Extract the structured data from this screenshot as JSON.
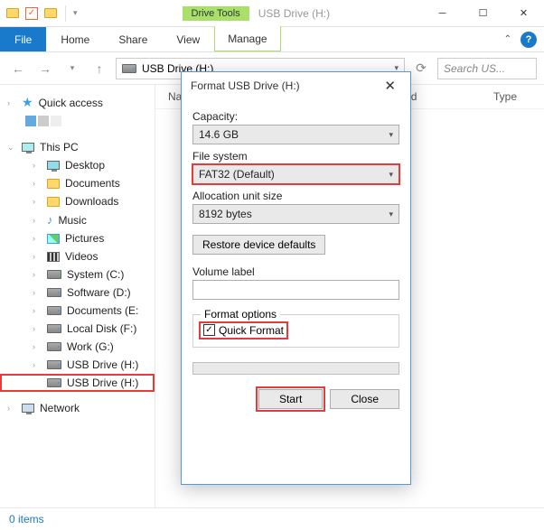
{
  "window": {
    "drive_tools_label": "Drive Tools",
    "title": "USB Drive (H:)"
  },
  "ribbon": {
    "file": "File",
    "home": "Home",
    "share": "Share",
    "view": "View",
    "manage": "Manage"
  },
  "address": {
    "location": "USB Drive (H:)",
    "search_placeholder": "Search US..."
  },
  "columns": {
    "name": "Name",
    "modified": "e modified",
    "type": "Type"
  },
  "sidebar": {
    "quick_access": "Quick access",
    "this_pc": "This PC",
    "items": [
      {
        "label": "Desktop"
      },
      {
        "label": "Documents"
      },
      {
        "label": "Downloads"
      },
      {
        "label": "Music"
      },
      {
        "label": "Pictures"
      },
      {
        "label": "Videos"
      },
      {
        "label": "System (C:)"
      },
      {
        "label": "Software (D:)"
      },
      {
        "label": "Documents (E:"
      },
      {
        "label": "Local Disk (F:)"
      },
      {
        "label": "Work (G:)"
      },
      {
        "label": "USB Drive (H:)"
      },
      {
        "label": "USB Drive (H:)"
      }
    ],
    "network": "Network"
  },
  "status": {
    "items": "0 items"
  },
  "dialog": {
    "title": "Format USB Drive (H:)",
    "capacity_label": "Capacity:",
    "capacity_value": "14.6 GB",
    "fs_label": "File system",
    "fs_value": "FAT32 (Default)",
    "alloc_label": "Allocation unit size",
    "alloc_value": "8192 bytes",
    "restore_btn": "Restore device defaults",
    "volume_label": "Volume label",
    "volume_value": "",
    "format_options": "Format options",
    "quick_format": "Quick Format",
    "start": "Start",
    "close": "Close"
  }
}
